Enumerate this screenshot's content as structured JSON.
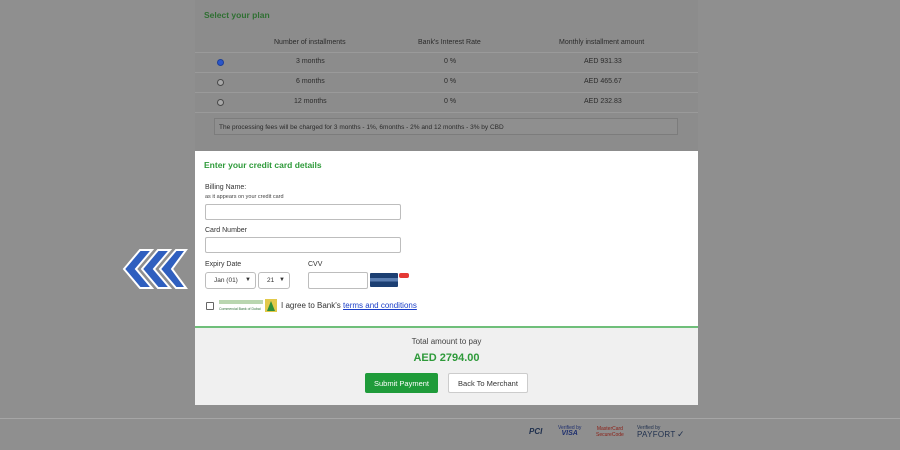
{
  "plan": {
    "title": "Select your plan",
    "headers": [
      "Number of installments",
      "Bank's Interest Rate",
      "Monthly installment amount"
    ],
    "rows": [
      {
        "installments": "3 months",
        "rate": "0 %",
        "amount": "AED 931.33",
        "selected": true
      },
      {
        "installments": "6 months",
        "rate": "0 %",
        "amount": "AED 465.67",
        "selected": false
      },
      {
        "installments": "12 months",
        "rate": "0 %",
        "amount": "AED 232.83",
        "selected": false
      }
    ],
    "fees_note": "The processing fees will be charged for 3 months - 1%, 6months - 2% and 12 months - 3% by CBD"
  },
  "card": {
    "title": "Enter your credit card details",
    "billing_name_label": "Billing Name:",
    "billing_name_hint": "as it appears on your credit card",
    "billing_name_value": "",
    "card_number_label": "Card Number",
    "card_number_value": "",
    "expiry_label": "Expiry Date",
    "expiry_month": "Jan (01)",
    "expiry_year": "21",
    "cvv_label": "CVV",
    "cvv_value": "",
    "bank_logo_text": "Commercial Bank of Dubai",
    "agree_text": "I agree to Bank's",
    "terms_link": "terms and conditions"
  },
  "summary": {
    "total_label": "Total amount to pay",
    "total_amount": "AED 2794.00",
    "submit_label": "Submit Payment",
    "back_label": "Back To Merchant"
  },
  "footer": {
    "pci": "PCI",
    "visa_top": "Verified by",
    "visa_brand": "VISA",
    "mc_top": "MasterCard",
    "mc_bottom": "SecureCode",
    "payfort_top": "Verified by",
    "payfort_brand": "PAYFORT"
  },
  "colors": {
    "accent_green": "#2e9a3a",
    "submit_green": "#1f9b3a",
    "overlay_gray": "#8f8f8f",
    "link_blue": "#1a3ec8",
    "logo_blue": "#2f5fbf"
  },
  "icons": {
    "side_logo": "blue-chevrons-logo",
    "cvv_card": "credit-card-back-icon"
  }
}
